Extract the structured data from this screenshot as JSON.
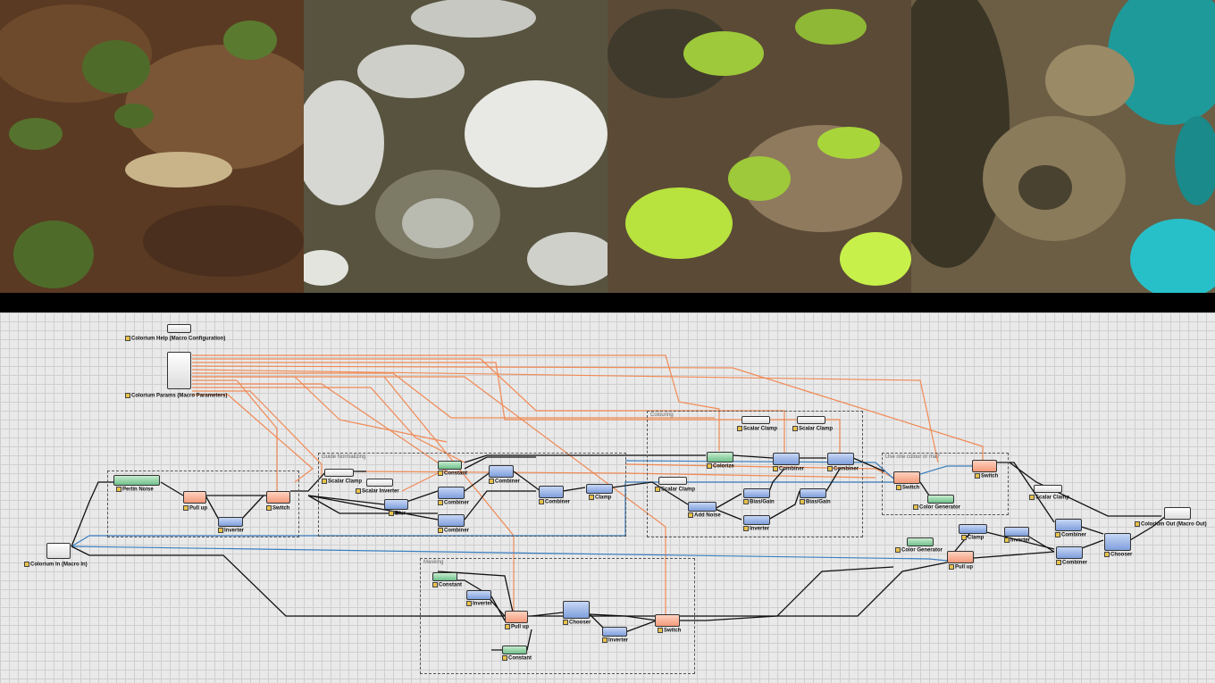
{
  "tiles": [
    {
      "name": "terrain-preview-1",
      "palette": [
        "#4a2f1e",
        "#6b4a2c",
        "#8a6a40",
        "#4f6b2a",
        "#c9b48a"
      ]
    },
    {
      "name": "terrain-preview-2",
      "palette": [
        "#4a4535",
        "#6b6650",
        "#8e8a76",
        "#d6d6d2",
        "#f2f2f0"
      ]
    },
    {
      "name": "terrain-preview-3",
      "palette": [
        "#3f3a2c",
        "#6b5a44",
        "#8f7a5e",
        "#9ec93a",
        "#c8f04a"
      ]
    },
    {
      "name": "terrain-preview-4",
      "palette": [
        "#3b3526",
        "#6b5e44",
        "#9a8a66",
        "#1e9a9a",
        "#28c0c8"
      ]
    }
  ],
  "graph": {
    "groups": [
      {
        "id": "g-perlin",
        "title": ""
      },
      {
        "id": "g-guide",
        "title": "Guide Normalizing"
      },
      {
        "id": "g-colouring",
        "title": "Colouring"
      },
      {
        "id": "g-useone",
        "title": "Use one colour or ma?"
      },
      {
        "id": "g-masking",
        "title": "Masking"
      }
    ],
    "nodes": [
      {
        "id": "help",
        "label": "Colorium Help (Macro Configuration)"
      },
      {
        "id": "params",
        "label": "Colorium Params (Macro Parameters)"
      },
      {
        "id": "in",
        "label": "Colorium In (Macro In)"
      },
      {
        "id": "out",
        "label": "Colorium Out (Macro Out)"
      },
      {
        "id": "perlin",
        "label": "Perlin Noise"
      },
      {
        "id": "pullup1",
        "label": "Pull up"
      },
      {
        "id": "inverter1",
        "label": "Inverter"
      },
      {
        "id": "switch1",
        "label": "Switch"
      },
      {
        "id": "scalarclamp1",
        "label": "Scalar Clamp"
      },
      {
        "id": "scalarinv",
        "label": "Scalar Inverter"
      },
      {
        "id": "blur",
        "label": "Blur"
      },
      {
        "id": "constant1",
        "label": "Constant"
      },
      {
        "id": "combiner1",
        "label": "Combiner"
      },
      {
        "id": "combiner2",
        "label": "Combiner"
      },
      {
        "id": "combiner3",
        "label": "Combiner"
      },
      {
        "id": "combiner4",
        "label": "Combiner"
      },
      {
        "id": "clamp1",
        "label": "Clamp"
      },
      {
        "id": "colorize",
        "label": "Colorize"
      },
      {
        "id": "scalarclamp2",
        "label": "Scalar Clamp"
      },
      {
        "id": "scalarclamp3",
        "label": "Scalar Clamp"
      },
      {
        "id": "combiner5",
        "label": "Combiner"
      },
      {
        "id": "combiner6",
        "label": "Combiner"
      },
      {
        "id": "scalarclamp4",
        "label": "Scalar Clamp"
      },
      {
        "id": "addnoise",
        "label": "Add Noise"
      },
      {
        "id": "biasgain1",
        "label": "Bias/Gain"
      },
      {
        "id": "biasgain2",
        "label": "Bias/Gain"
      },
      {
        "id": "inverter2",
        "label": "Inverter"
      },
      {
        "id": "switch2",
        "label": "Switch"
      },
      {
        "id": "switch3",
        "label": "Switch"
      },
      {
        "id": "colorgen1",
        "label": "Color Generator"
      },
      {
        "id": "scalarclamp5",
        "label": "Scalar Clamp"
      },
      {
        "id": "clamp2",
        "label": "Clamp"
      },
      {
        "id": "inverter3",
        "label": "Inverter"
      },
      {
        "id": "combiner7",
        "label": "Combiner"
      },
      {
        "id": "combiner8",
        "label": "Combiner"
      },
      {
        "id": "chooser1",
        "label": "Chooser"
      },
      {
        "id": "colorgen2",
        "label": "Color Generator"
      },
      {
        "id": "pullup2",
        "label": "Pull up"
      },
      {
        "id": "constant2",
        "label": "Constant"
      },
      {
        "id": "inverter4",
        "label": "Inverter"
      },
      {
        "id": "pullup3",
        "label": "Pull up"
      },
      {
        "id": "constant3",
        "label": "Constant"
      },
      {
        "id": "chooser2",
        "label": "Chooser"
      },
      {
        "id": "inverter5",
        "label": "Inverter"
      },
      {
        "id": "switch4",
        "label": "Switch"
      }
    ],
    "colors": {
      "param_wire": "#f08a55",
      "data_wire": "#111111",
      "mask_wire": "#3a7fc0"
    }
  }
}
